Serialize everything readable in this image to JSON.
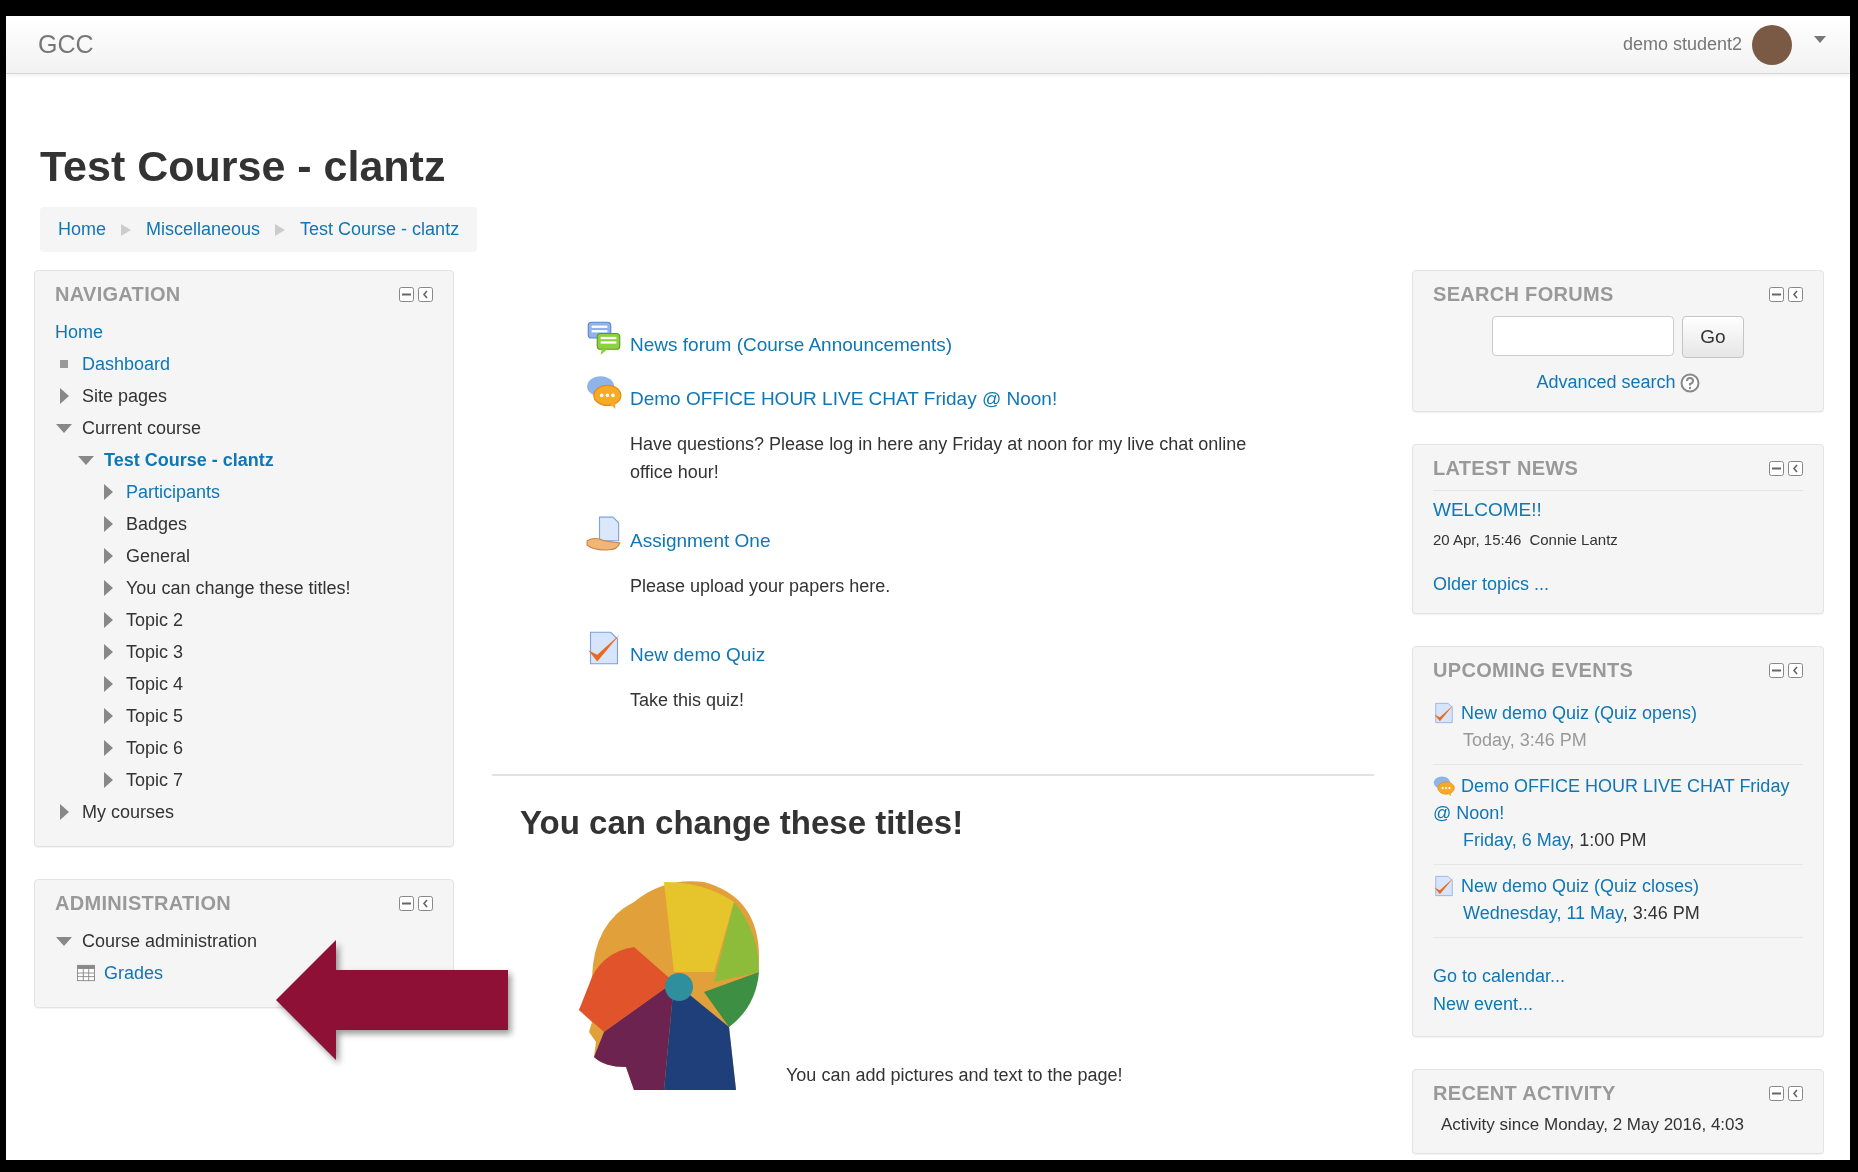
{
  "navbar": {
    "brand": "GCC",
    "user": "demo student2"
  },
  "page_title": "Test Course - clantz",
  "breadcrumb": [
    "Home",
    "Miscellaneous",
    "Test Course - clantz"
  ],
  "navigation": {
    "title": "NAVIGATION",
    "items": [
      {
        "label": "Home",
        "kind": "plain",
        "link": true,
        "current": false,
        "children": [
          {
            "label": "Dashboard",
            "kind": "bullet",
            "link": true,
            "current": false
          },
          {
            "label": "Site pages",
            "kind": "branch",
            "expanded": false,
            "link": false,
            "current": false
          },
          {
            "label": "Current course",
            "kind": "branch",
            "expanded": true,
            "link": false,
            "current": false,
            "children": [
              {
                "label": "Test Course - clantz",
                "kind": "branch",
                "expanded": true,
                "link": true,
                "current": true,
                "children": [
                  {
                    "label": "Participants",
                    "kind": "branch",
                    "expanded": false,
                    "link": true,
                    "current": false
                  },
                  {
                    "label": "Badges",
                    "kind": "branch",
                    "expanded": false,
                    "link": false,
                    "current": false
                  },
                  {
                    "label": "General",
                    "kind": "branch",
                    "expanded": false,
                    "link": false,
                    "current": false
                  },
                  {
                    "label": "You can change these titles!",
                    "kind": "branch",
                    "expanded": false,
                    "link": false,
                    "current": false
                  },
                  {
                    "label": "Topic 2",
                    "kind": "branch",
                    "expanded": false,
                    "link": false,
                    "current": false
                  },
                  {
                    "label": "Topic 3",
                    "kind": "branch",
                    "expanded": false,
                    "link": false,
                    "current": false
                  },
                  {
                    "label": "Topic 4",
                    "kind": "branch",
                    "expanded": false,
                    "link": false,
                    "current": false
                  },
                  {
                    "label": "Topic 5",
                    "kind": "branch",
                    "expanded": false,
                    "link": false,
                    "current": false
                  },
                  {
                    "label": "Topic 6",
                    "kind": "branch",
                    "expanded": false,
                    "link": false,
                    "current": false
                  },
                  {
                    "label": "Topic 7",
                    "kind": "branch",
                    "expanded": false,
                    "link": false,
                    "current": false
                  }
                ]
              }
            ]
          },
          {
            "label": "My courses",
            "kind": "branch",
            "expanded": false,
            "link": false,
            "current": false
          }
        ]
      }
    ]
  },
  "administration": {
    "title": "ADMINISTRATION",
    "items": [
      {
        "label": "Course administration",
        "kind": "branch",
        "expanded": true,
        "link": false,
        "current": false,
        "children": [
          {
            "label": "Grades",
            "kind": "grades",
            "link": true,
            "current": false
          }
        ]
      }
    ]
  },
  "activities": [
    {
      "kind": "forum",
      "title": "News forum (Course Announcements)"
    },
    {
      "kind": "chat",
      "title": "Demo OFFICE HOUR LIVE CHAT Friday @ Noon!",
      "description": "Have questions? Please log in here any Friday at noon for my live chat online office hour!"
    },
    {
      "kind": "assignment",
      "title": "Assignment One",
      "description": "Please upload your papers here."
    },
    {
      "kind": "quiz",
      "title": "New demo Quiz",
      "description": "Take this quiz!"
    }
  ],
  "section": {
    "title": "You can change these titles!",
    "caption": "You can add pictures and text to the page!"
  },
  "search_forums": {
    "title": "SEARCH FORUMS",
    "button": "Go",
    "advanced": "Advanced search"
  },
  "latest_news": {
    "title": "LATEST NEWS",
    "items": [
      {
        "title": "WELCOME!!",
        "date": "20 Apr, 15:46",
        "author": "Connie Lantz"
      }
    ],
    "more": "Older topics ..."
  },
  "upcoming_events": {
    "title": "UPCOMING EVENTS",
    "events": [
      {
        "kind": "quiz",
        "title": "New demo Quiz (Quiz opens)",
        "day": "Today",
        "time": ", 3:46 PM",
        "dimmed": true
      },
      {
        "kind": "chat",
        "title": "Demo OFFICE HOUR LIVE CHAT Friday @ Noon!",
        "day": "Friday, 6 May",
        "time": ", 1:00 PM",
        "dimmed": false
      },
      {
        "kind": "quiz",
        "title": "New demo Quiz (Quiz closes)",
        "day": "Wednesday, 11 May",
        "time": ", 3:46 PM",
        "dimmed": false
      }
    ],
    "links": [
      "Go to calendar...",
      "New event..."
    ]
  },
  "recent_activity": {
    "title": "RECENT ACTIVITY",
    "text": "Activity since Monday, 2 May 2016, 4:03"
  }
}
